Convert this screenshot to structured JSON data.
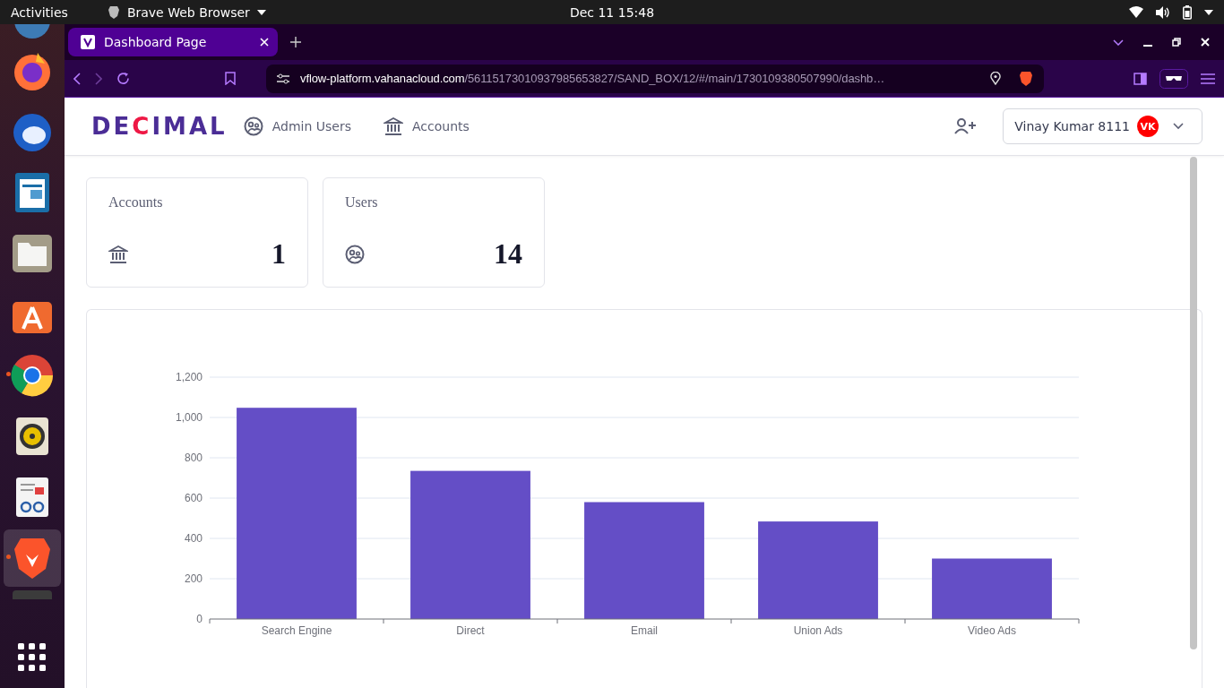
{
  "top_bar": {
    "activities": "Activities",
    "app_menu": "Brave Web Browser",
    "clock": "Dec 11  15:48"
  },
  "dock": {
    "items": [
      {
        "kind": "partial"
      },
      {
        "kind": "fox"
      },
      {
        "kind": "bird"
      },
      {
        "kind": "doc"
      },
      {
        "kind": "folder"
      },
      {
        "kind": "store"
      },
      {
        "kind": "wheel",
        "running": true
      },
      {
        "kind": "speaker"
      },
      {
        "kind": "reader"
      },
      {
        "kind": "lion",
        "running": true,
        "selected": true
      },
      {
        "kind": "terminal"
      }
    ]
  },
  "browser": {
    "tabs": [
      {
        "title": "Dashboard Page",
        "selected": true
      }
    ],
    "address": {
      "host": "vflow-platform.vahanacloud.com",
      "path": "/56115173010937985653827/SAND_BOX/12/#/main/1730109380507990/dashb…"
    }
  },
  "header": {
    "logo": [
      {
        "text": "DE",
        "accent": false
      },
      {
        "text": "C",
        "accent": true
      },
      {
        "text": "IMAL",
        "accent": false
      }
    ],
    "nav": [
      {
        "label": "Admin Users",
        "kind": "users"
      },
      {
        "label": "Accounts",
        "kind": "bank"
      }
    ],
    "user": {
      "name": "Vinay Kumar 8111",
      "initials": "VK"
    }
  },
  "cards": [
    {
      "title": "Accounts",
      "value": "1",
      "kind": "bank"
    },
    {
      "title": "Users",
      "value": "14",
      "kind": "users"
    }
  ],
  "chart_data": {
    "type": "bar",
    "categories": [
      "Search Engine",
      "Direct",
      "Email",
      "Union Ads",
      "Video Ads"
    ],
    "grid": true,
    "series": [
      {
        "color": "#644ec6",
        "values": [
          1048,
          735,
          580,
          484,
          300
        ]
      }
    ],
    "ylim": [
      0,
      1200
    ],
    "yticks": [
      0,
      200,
      400,
      600,
      800,
      {
        "value": 1000,
        "label": "1,000"
      },
      {
        "value": 1200,
        "label": "1,200"
      }
    ]
  }
}
